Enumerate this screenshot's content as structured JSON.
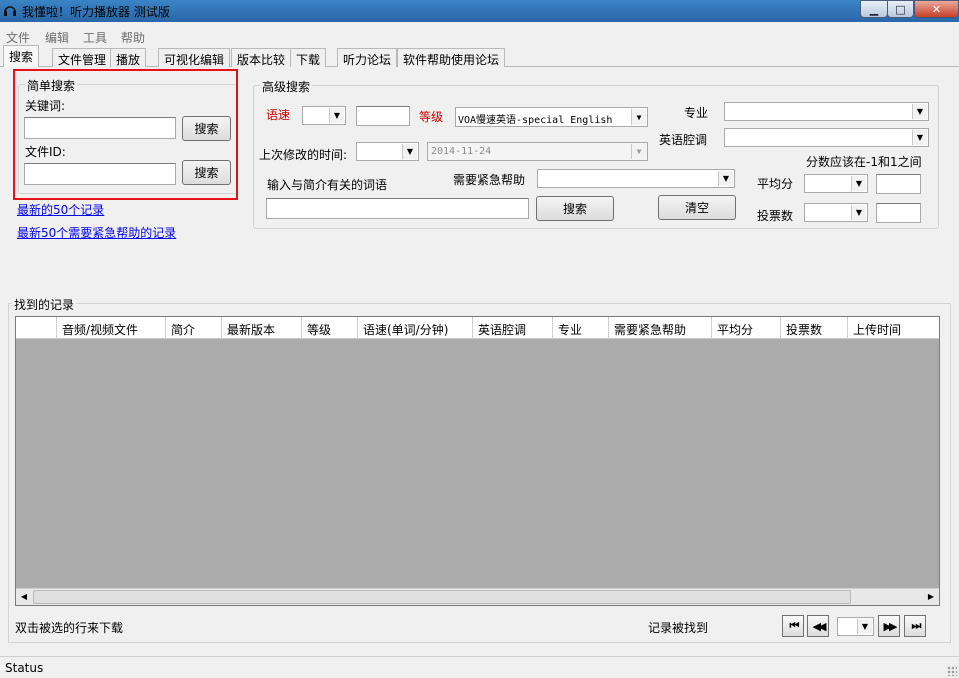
{
  "window": {
    "title": "我懂啦！听力播放器 测试版"
  },
  "menu": [
    "文件",
    "编辑",
    "工具",
    "帮助"
  ],
  "tabs": [
    "搜索",
    "文件管理",
    "播放",
    "可视化编辑",
    "版本比较",
    "下载",
    "听力论坛",
    "软件帮助使用论坛"
  ],
  "simple_search": {
    "title": "简单搜索",
    "keyword_label": "关键词:",
    "keyword_value": "",
    "keyword_button": "搜索",
    "fileid_label": "文件ID:",
    "fileid_value": "",
    "fileid_button": "搜索"
  },
  "links": {
    "latest_50": "最新的50个记录",
    "latest_50_help": "最新50个需要紧急帮助的记录"
  },
  "advanced_search": {
    "title": "高级搜索",
    "speed_label": "语速",
    "speed_value": "",
    "level_label": "等级",
    "level_value": "VOA慢速英语-special English",
    "major_label": "专业",
    "major_value": "",
    "accent_label": "英语腔调",
    "accent_value": "",
    "last_modified_label": "上次修改的时间:",
    "last_modified_op": "",
    "last_modified_date": "2014-11-24",
    "score_hint": "分数应该在-1和1之间",
    "intro_label": "输入与简介有关的词语",
    "intro_value": "",
    "urgent_label": "需要紧急帮助",
    "urgent_value": "",
    "avg_score_label": "平均分",
    "votes_label": "投票数",
    "search_button": "搜索",
    "clear_button": "清空"
  },
  "results": {
    "title": "找到的记录",
    "columns": [
      "",
      "音频/视频文件",
      "简介",
      "最新版本",
      "等级",
      "语速(单词/分钟)",
      "英语腔调",
      "专业",
      "需要紧急帮助",
      "平均分",
      "投票数",
      "上传时间"
    ],
    "hint": "双击被选的行来下载",
    "found_label": "记录被找到",
    "page_value": ""
  },
  "nav": {
    "first": "⏮",
    "prev": "◀◀",
    "next": "▶▶",
    "last": "⏭"
  },
  "status": {
    "text": "Status"
  },
  "colors": {
    "highlight_box": "#e8101a",
    "required_label": "#d00000",
    "link": "#0000ee",
    "grid_bg": "#ababab"
  }
}
